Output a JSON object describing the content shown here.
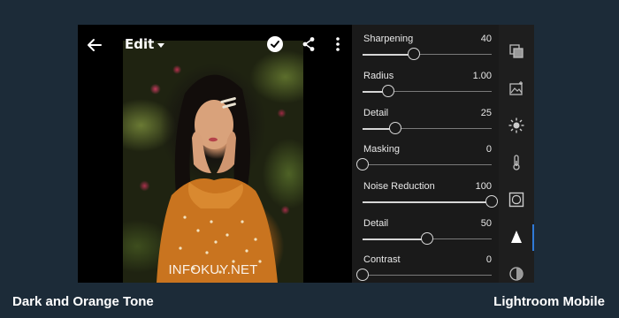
{
  "topbar": {
    "edit_label": "Edit"
  },
  "photo": {
    "watermark": "INFOKUY.NET"
  },
  "detail_panel": {
    "sliders": [
      {
        "label": "Sharpening",
        "value": "40",
        "level": 0.4
      },
      {
        "label": "Radius",
        "value": "1.00",
        "level": 0.2
      },
      {
        "label": "Detail",
        "value": "25",
        "level": 0.25
      },
      {
        "label": "Masking",
        "value": "0",
        "level": 0.0
      },
      {
        "label": "Noise Reduction",
        "value": "100",
        "level": 1.0
      },
      {
        "label": "Detail",
        "value": "50",
        "level": 0.5
      },
      {
        "label": "Contrast",
        "value": "0",
        "level": 0.0
      }
    ]
  },
  "tools": [
    "presets-icon",
    "crop-icon",
    "light-icon",
    "color-icon",
    "effects-icon",
    "detail-icon",
    "optics-icon"
  ],
  "active_tool": "detail-icon",
  "accent_color": "#2f7ad8",
  "captions": {
    "left": "Dark and Orange Tone",
    "right": "Lightroom Mobile"
  }
}
